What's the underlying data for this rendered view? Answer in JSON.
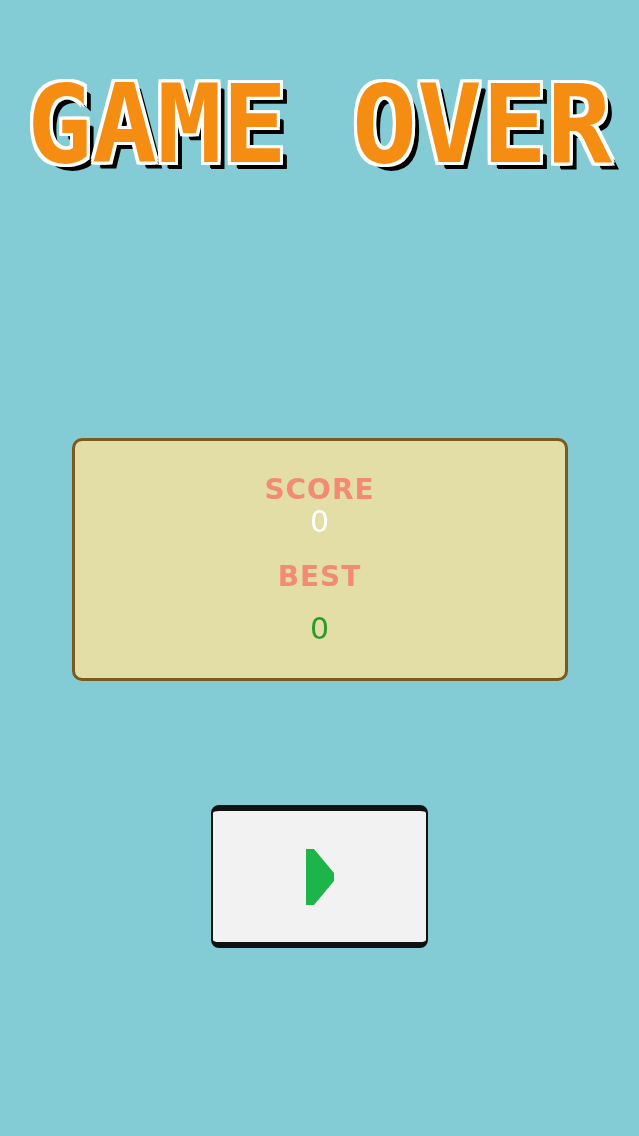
{
  "title": "GAME OVER",
  "score_panel": {
    "score_label": "SCORE",
    "score": "0",
    "best_label": "BEST",
    "best": "0"
  }
}
